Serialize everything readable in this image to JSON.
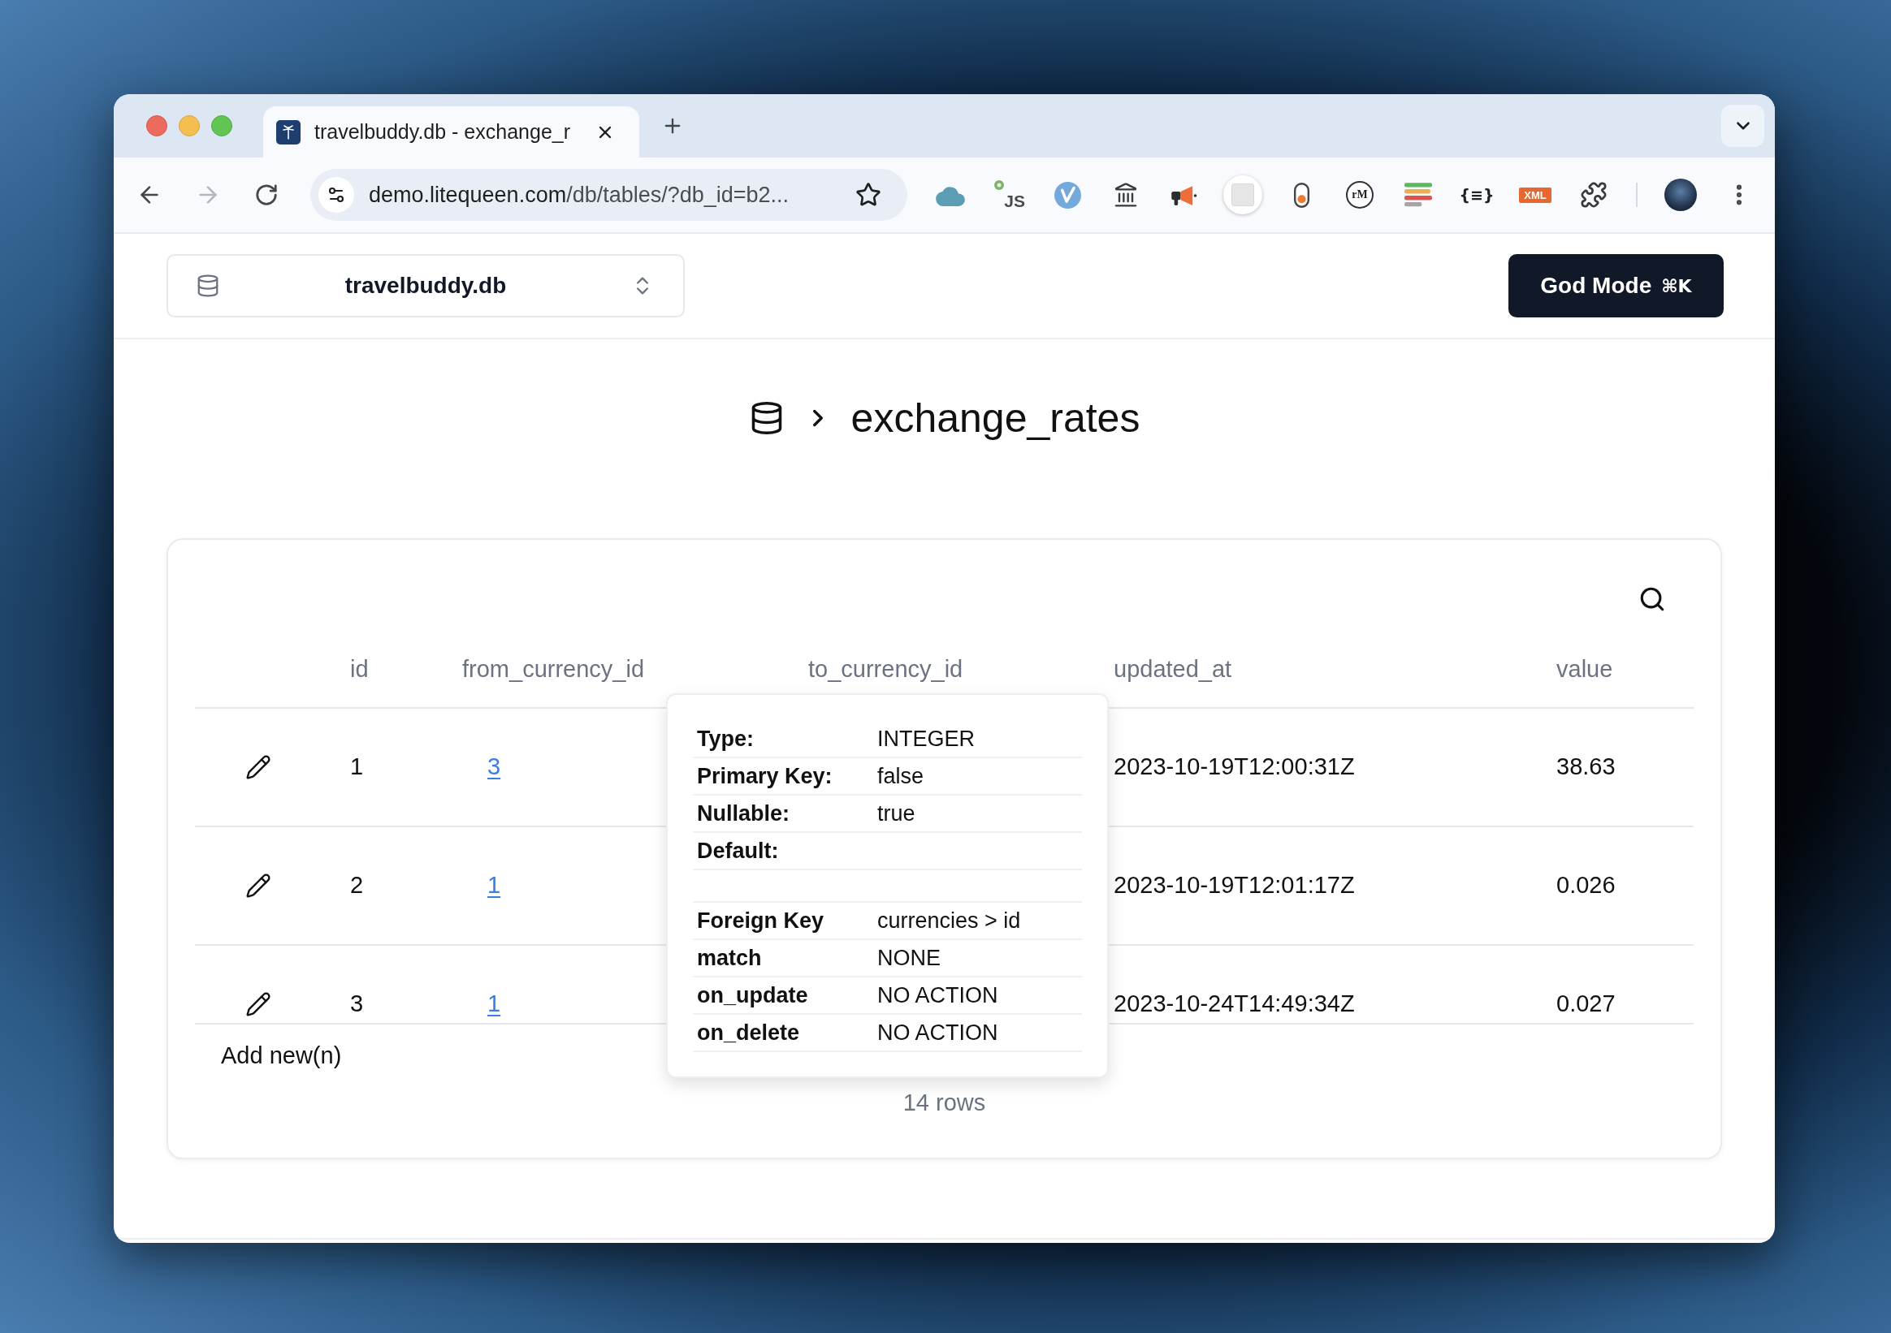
{
  "browser": {
    "tabs": [
      {
        "title": "travelbuddy.db - exchange_r",
        "selected": true
      }
    ],
    "back": {
      "disabled": false
    },
    "forward": {
      "disabled": true
    },
    "address": {
      "host": "demo.litequeen.com",
      "path": "/db/tables/?db_id=b2..."
    },
    "extensions": [
      {
        "kind": "cloud"
      },
      {
        "kind": "script",
        "text": "JS"
      },
      {
        "kind": "check-badge"
      },
      {
        "kind": "landmark"
      },
      {
        "kind": "megaphone"
      },
      {
        "kind": "pattern"
      },
      {
        "kind": "toggle"
      },
      {
        "kind": "circle-text",
        "text": "rM"
      },
      {
        "kind": "bars"
      },
      {
        "kind": "plain-text",
        "text": "{≡}"
      },
      {
        "kind": "tag",
        "text": "XML"
      },
      {
        "kind": "puzzle"
      }
    ]
  },
  "app_header": {
    "database": "travelbuddy.db",
    "god_mode": {
      "label": "God Mode",
      "shortcut": "⌘K"
    }
  },
  "breadcrumb": {
    "table_name": "exchange_rates"
  },
  "table": {
    "columns": [
      "id",
      "from_currency_id",
      "to_currency_id",
      "updated_at",
      "value"
    ],
    "rows": [
      {
        "id": "1",
        "from_currency_id": "3",
        "updated_at": "2023-10-19T12:00:31Z",
        "value": "38.63"
      },
      {
        "id": "2",
        "from_currency_id": "1",
        "updated_at": "2023-10-19T12:01:17Z",
        "value": "0.026"
      },
      {
        "id": "3",
        "from_currency_id": "1",
        "updated_at": "2023-10-24T14:49:34Z",
        "value": "0.027"
      }
    ],
    "add_row": "Add new(n)",
    "row_count": "14 rows"
  },
  "column_tooltip": {
    "details": [
      {
        "label": "Type:",
        "value": "INTEGER"
      },
      {
        "label": "Primary Key:",
        "value": "false"
      },
      {
        "label": "Nullable:",
        "value": "true"
      },
      {
        "label": "Default:"
      }
    ],
    "foreign_key": [
      {
        "label": "Foreign Key",
        "value": "currencies > id"
      },
      {
        "label": "match",
        "value": "NONE"
      },
      {
        "label": "on_update",
        "value": "NO ACTION"
      },
      {
        "label": "on_delete",
        "value": "NO ACTION"
      }
    ]
  }
}
